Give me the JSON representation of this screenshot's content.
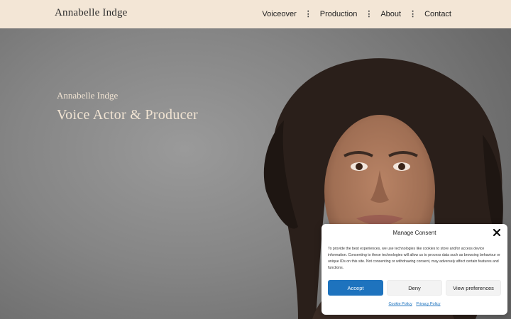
{
  "header": {
    "logo": "Annabelle Indge",
    "nav": [
      {
        "label": "Voiceover"
      },
      {
        "label": "Production"
      },
      {
        "label": "About"
      },
      {
        "label": "Contact"
      }
    ]
  },
  "hero": {
    "subtitle": "Annabelle Indge",
    "title": "Voice Actor & Producer"
  },
  "consent": {
    "title": "Manage Consent",
    "text": "To provide the best experiences, we use technologies like cookies to store and/or access device information. Consenting to these technologies will allow us to process data such as browsing behaviour or unique IDs on this site. Not consenting or withdrawing consent, may adversely affect certain features and functions.",
    "accept_label": "Accept",
    "deny_label": "Deny",
    "preferences_label": "View preferences",
    "cookie_policy_label": "Cookie Policy",
    "privacy_policy_label": "Privacy Policy"
  },
  "colors": {
    "header_bg": "#f3e6d6",
    "hero_text": "#f1e4d3",
    "accent": "#1e73be"
  }
}
